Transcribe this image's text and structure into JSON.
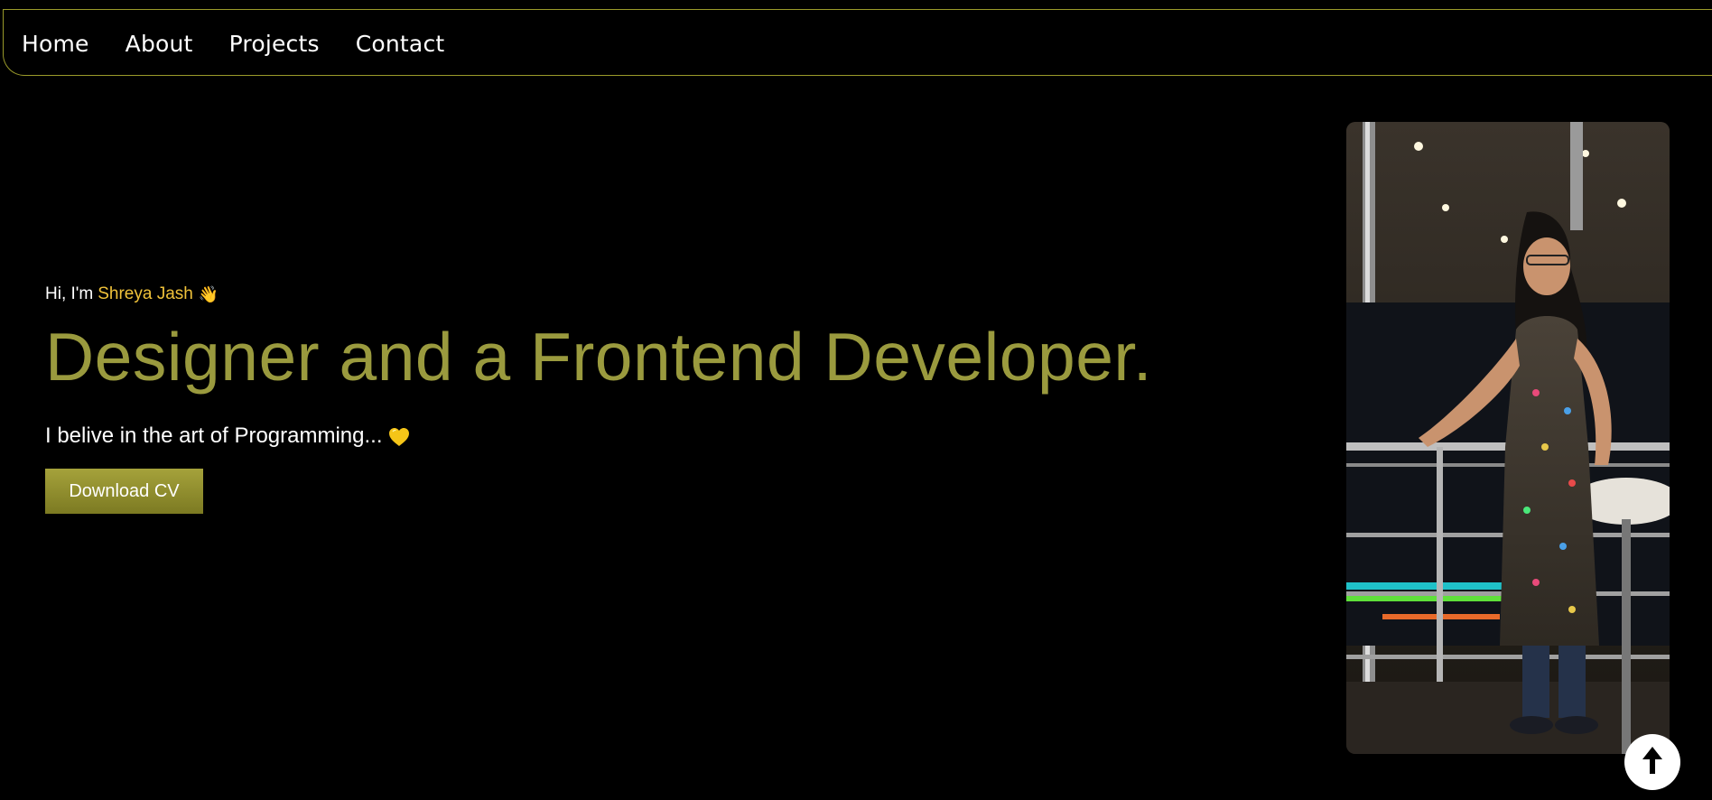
{
  "nav": {
    "items": [
      {
        "label": "Home"
      },
      {
        "label": "About"
      },
      {
        "label": "Projects"
      },
      {
        "label": "Contact"
      }
    ]
  },
  "hero": {
    "greeting_prefix": "Hi, I'm",
    "name": "Shreya Jash",
    "wave_emoji": "👋",
    "headline": "Designer and a Frontend Developer.",
    "tagline": "I belive in the art of Programming...",
    "heart_icon": "yellow-heart-icon",
    "cv_button_label": "Download CV"
  },
  "photo": {
    "alt": "profile-photo"
  },
  "scroll_top": {
    "icon": "arrow-up-icon"
  },
  "colors": {
    "accent_gold": "#f0c23a",
    "headline_olive": "#9a9a3e",
    "button_olive": "#8f8d2e",
    "nav_border": "#9a9a2a",
    "background": "#000000"
  }
}
